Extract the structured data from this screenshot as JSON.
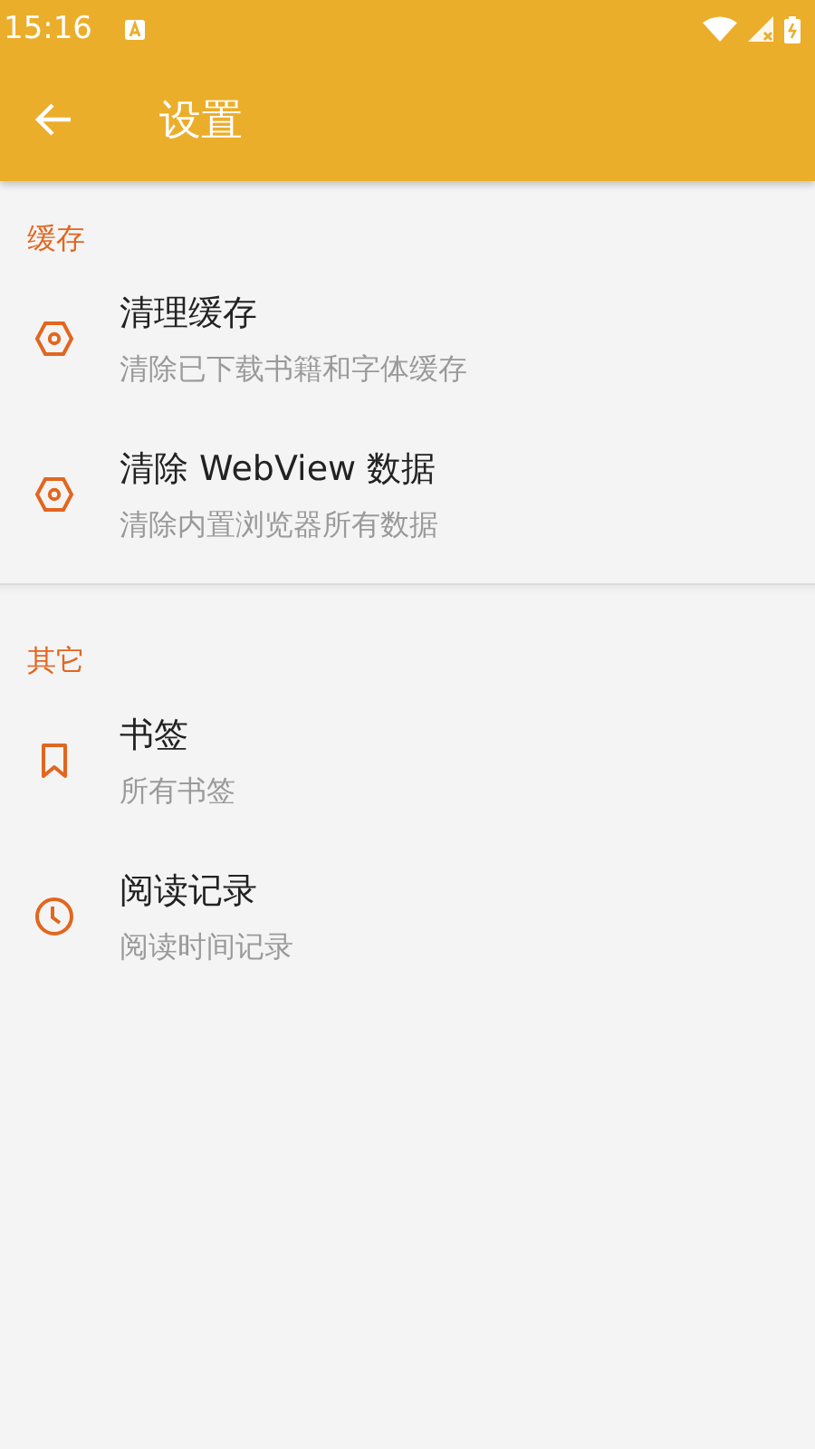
{
  "status_bar": {
    "time": "15:16"
  },
  "app_bar": {
    "title": "设置"
  },
  "sections": [
    {
      "title": "缓存",
      "items": [
        {
          "kind": "clear",
          "title": "清理缓存",
          "subtitle": "清除已下载书籍和字体缓存"
        },
        {
          "kind": "clear",
          "title": "清除 WebView 数据",
          "subtitle": "清除内置浏览器所有数据"
        }
      ]
    },
    {
      "title": "其它",
      "items": [
        {
          "kind": "bookmarks",
          "title": "书签",
          "subtitle": "所有书签"
        },
        {
          "kind": "history",
          "title": "阅读记录",
          "subtitle": "阅读时间记录"
        }
      ]
    }
  ]
}
